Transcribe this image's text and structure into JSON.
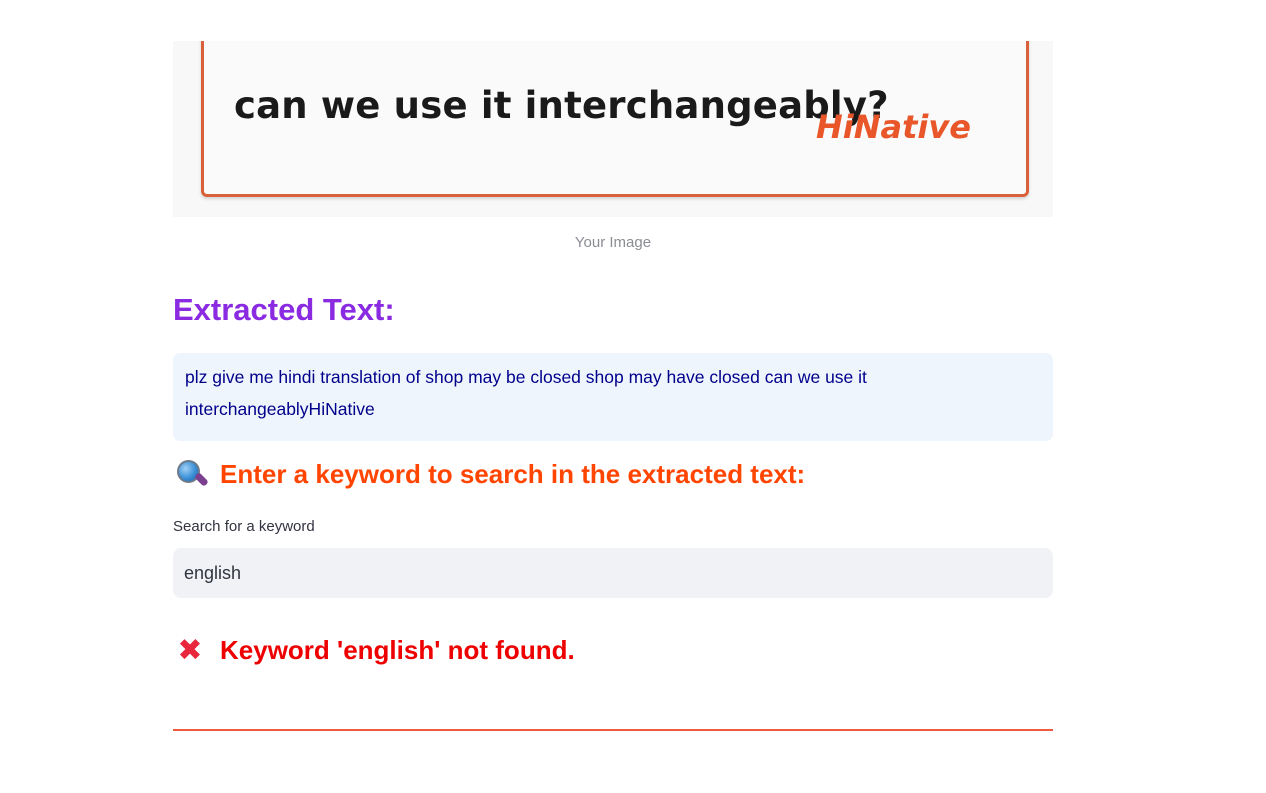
{
  "image_preview": {
    "text_line": "can we use it interchangeably?",
    "logo_text": "HiNative",
    "caption": "Your Image"
  },
  "extracted": {
    "heading": "Extracted Text:",
    "text": "plz give me hindi translation of shop may be closed shop may have closed can we use it interchangeablyHiNative"
  },
  "search": {
    "heading": "Enter a keyword to search in the extracted text:",
    "heading_icon": "magnifying-glass-icon",
    "label": "Search for a keyword",
    "value": "english"
  },
  "result": {
    "icon": "cross-mark-icon",
    "message": "Keyword 'english' not found."
  },
  "colors": {
    "extracted_heading": "#8a2be2",
    "search_heading": "#ff4500",
    "error": "#ee0000",
    "extracted_text": "#00008b",
    "text_box_bg": "#eef5fc",
    "divider": "#f05a3e"
  }
}
